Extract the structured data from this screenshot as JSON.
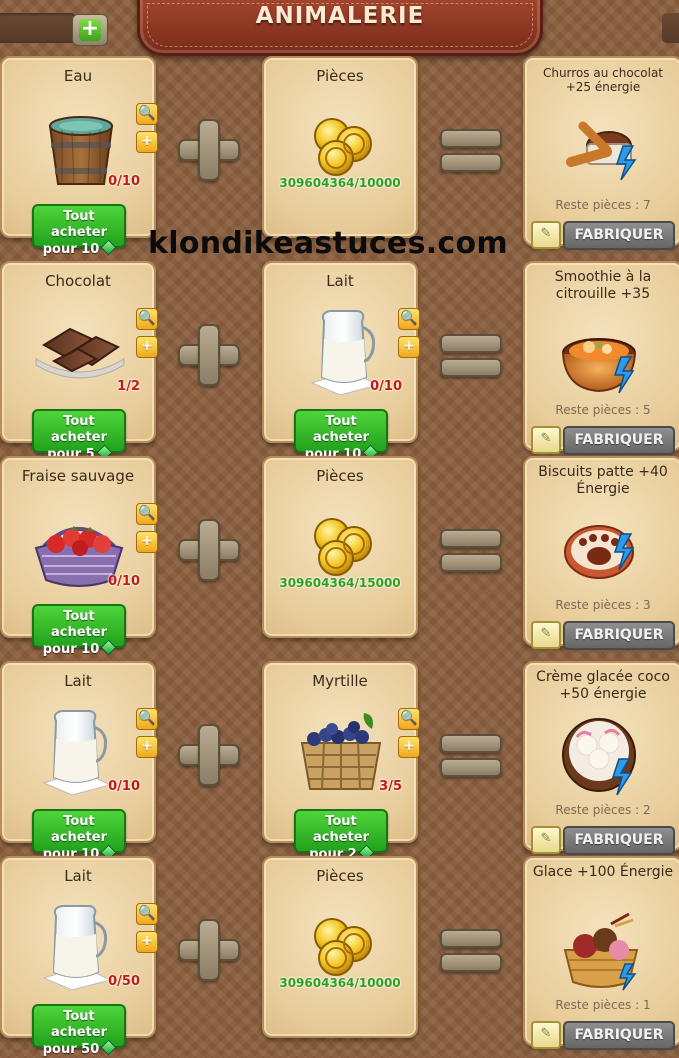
{
  "header": {
    "title": "ANIMALERIE",
    "add_currency_symbol": "+"
  },
  "watermark": "klondikeastuces.com",
  "ui": {
    "craft_label": "FABRIQUER",
    "search_symbol": "🔍",
    "plus_symbol": "+",
    "book_symbol": "✎"
  },
  "rows": [
    {
      "first": {
        "name": "Eau",
        "icon": "water-bucket-icon",
        "count": "0/10",
        "buy_line1": "Tout acheter",
        "buy_line2": "pour 10"
      },
      "second": {
        "name": "Pièces",
        "icon": "coins-icon",
        "count": "309604364/10000"
      },
      "result": {
        "name": "Churros au chocolat +25 énergie",
        "icon": "churros-icon",
        "remaining": "Reste pièces : 7"
      }
    },
    {
      "first": {
        "name": "Chocolat",
        "icon": "chocolate-icon",
        "count": "1/2",
        "buy_line1": "Tout acheter",
        "buy_line2": "pour 5"
      },
      "second": {
        "name": "Lait",
        "icon": "milk-jug-icon",
        "count": "0/10",
        "buy_line1": "Tout acheter",
        "buy_line2": "pour 10"
      },
      "result": {
        "name": "Smoothie à la citrouille +35",
        "icon": "pumpkin-smoothie-icon",
        "remaining": "Reste pièces : 5"
      }
    },
    {
      "first": {
        "name": "Fraise sauvage",
        "icon": "strawberry-basket-icon",
        "count": "0/10",
        "buy_line1": "Tout acheter",
        "buy_line2": "pour 10"
      },
      "second": {
        "name": "Pièces",
        "icon": "coins-icon",
        "count": "309604364/15000"
      },
      "result": {
        "name": "Biscuits patte +40 Énergie",
        "icon": "paw-biscuit-icon",
        "remaining": "Reste pièces : 3"
      }
    },
    {
      "first": {
        "name": "Lait",
        "icon": "milk-jug-icon",
        "count": "0/10",
        "buy_line1": "Tout acheter",
        "buy_line2": "pour 10"
      },
      "second": {
        "name": "Myrtille",
        "icon": "blueberry-basket-icon",
        "count": "3/5",
        "buy_line1": "Tout acheter",
        "buy_line2": "pour 2"
      },
      "result": {
        "name": "Crème glacée coco +50 énergie",
        "icon": "coconut-ice-cream-icon",
        "remaining": "Reste pièces : 2"
      }
    },
    {
      "first": {
        "name": "Lait",
        "icon": "milk-jug-icon",
        "count": "0/50",
        "buy_line1": "Tout acheter",
        "buy_line2": "pour 50"
      },
      "second": {
        "name": "Pièces",
        "icon": "coins-icon",
        "count": "309604364/10000"
      },
      "result": {
        "name": "Glace +100 Énergie",
        "icon": "ice-cream-bowl-icon",
        "remaining": "Reste pièces : 1"
      }
    }
  ],
  "colors": {
    "background": "#8a5e3d",
    "card": "#ecd5a6",
    "buy_button": "#2fb827",
    "count_red": "#c21a12",
    "coins_green": "#2f9e1a",
    "title_plate": "#8c3722"
  }
}
